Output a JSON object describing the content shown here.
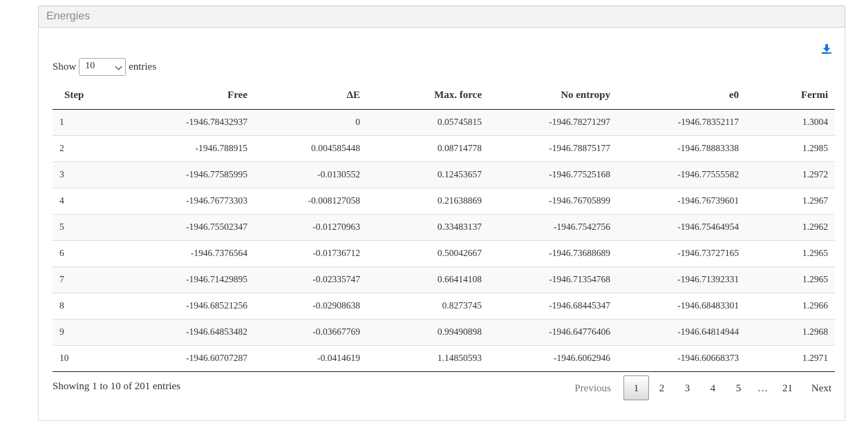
{
  "panel": {
    "title": "Energies"
  },
  "length": {
    "prefix": "Show",
    "value": "10",
    "suffix": "entries"
  },
  "table": {
    "columns": [
      "Step",
      "Free",
      "ΔE",
      "Max. force",
      "No entropy",
      "e0",
      "Fermi"
    ],
    "rows": [
      [
        "1",
        "-1946.78432937",
        "0",
        "0.05745815",
        "-1946.78271297",
        "-1946.78352117",
        "1.3004"
      ],
      [
        "2",
        "-1946.788915",
        "0.004585448",
        "0.08714778",
        "-1946.78875177",
        "-1946.78883338",
        "1.2985"
      ],
      [
        "3",
        "-1946.77585995",
        "-0.0130552",
        "0.12453657",
        "-1946.77525168",
        "-1946.77555582",
        "1.2972"
      ],
      [
        "4",
        "-1946.76773303",
        "-0.008127058",
        "0.21638869",
        "-1946.76705899",
        "-1946.76739601",
        "1.2967"
      ],
      [
        "5",
        "-1946.75502347",
        "-0.01270963",
        "0.33483137",
        "-1946.7542756",
        "-1946.75464954",
        "1.2962"
      ],
      [
        "6",
        "-1946.7376564",
        "-0.01736712",
        "0.50042667",
        "-1946.73688689",
        "-1946.73727165",
        "1.2965"
      ],
      [
        "7",
        "-1946.71429895",
        "-0.02335747",
        "0.66414108",
        "-1946.71354768",
        "-1946.71392331",
        "1.2965"
      ],
      [
        "8",
        "-1946.68521256",
        "-0.02908638",
        "0.8273745",
        "-1946.68445347",
        "-1946.68483301",
        "1.2966"
      ],
      [
        "9",
        "-1946.64853482",
        "-0.03667769",
        "0.99490898",
        "-1946.64776406",
        "-1946.64814944",
        "1.2968"
      ],
      [
        "10",
        "-1946.60707287",
        "-0.0414619",
        "1.14850593",
        "-1946.6062946",
        "-1946.60668373",
        "1.2971"
      ]
    ]
  },
  "info": "Showing 1 to 10 of 201 entries",
  "pagination": {
    "previous": "Previous",
    "pages": [
      "1",
      "2",
      "3",
      "4",
      "5"
    ],
    "ellipsis": "…",
    "last": "21",
    "next": "Next",
    "current": "1"
  },
  "icons": {
    "download": "download-icon"
  },
  "colors": {
    "accent": "#1a73d9",
    "header_bg": "#f3f3f3"
  }
}
